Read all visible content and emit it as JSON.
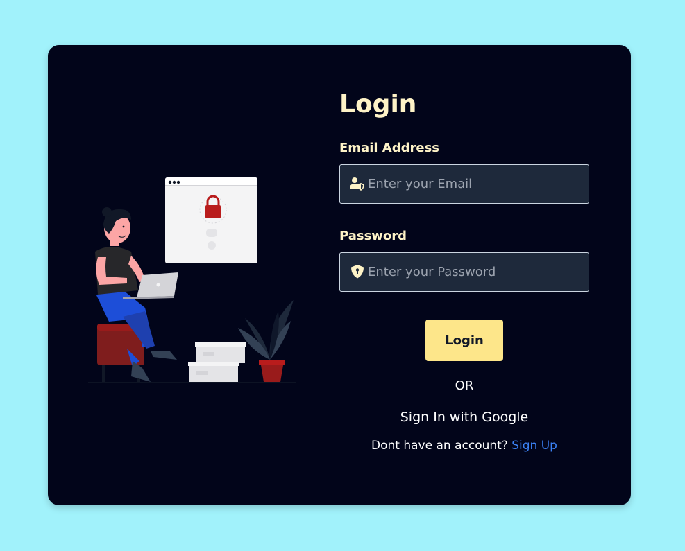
{
  "login": {
    "title": "Login",
    "email": {
      "label": "Email Address",
      "placeholder": "Enter your Email",
      "value": "",
      "icon": "user-shield-icon"
    },
    "password": {
      "label": "Password",
      "placeholder": "Enter your Password",
      "value": "",
      "icon": "shield-keyhole-icon"
    },
    "submit_label": "Login",
    "divider_text": "OR",
    "google_label": "Sign In with Google",
    "signup_prompt": "Dont have an account?",
    "signup_link": "Sign Up"
  },
  "colors": {
    "page_background": "#a1f2fb",
    "card_background": "#02051a",
    "heading": "#fef3c7",
    "input_background": "#1e293b",
    "button": "#fde68a",
    "link": "#3b82f6"
  }
}
